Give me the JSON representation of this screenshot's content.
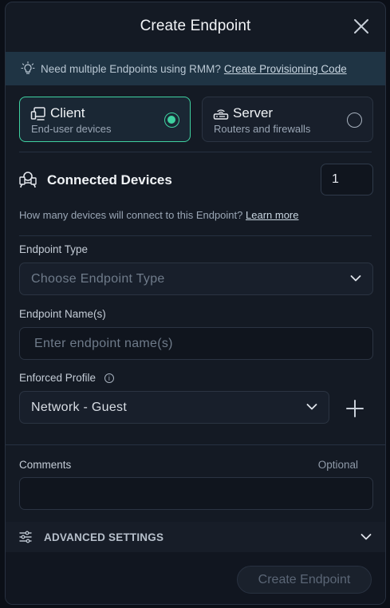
{
  "dialog": {
    "title": "Create Endpoint",
    "banner": {
      "text": "Need multiple Endpoints using RMM?",
      "link": "Create Provisioning Code"
    },
    "options": [
      {
        "name": "Client",
        "description": "End-user devices",
        "selected": true
      },
      {
        "name": "Server",
        "description": "Routers and firewalls",
        "selected": false
      }
    ],
    "connected_devices": {
      "title": "Connected Devices",
      "count": "1",
      "hint": "How many devices will connect to this Endpoint?",
      "hint_link": "Learn more"
    },
    "endpoint_type": {
      "label": "Endpoint Type",
      "placeholder": "Choose Endpoint Type"
    },
    "endpoint_name": {
      "label": "Endpoint Name(s)",
      "placeholder": "Enter endpoint name(s)"
    },
    "enforced_profile": {
      "label": "Enforced Profile",
      "info_glyph": "i",
      "value": "Network - Guest"
    },
    "comments": {
      "label": "Comments",
      "optional": "Optional",
      "value": ""
    },
    "advanced_settings": "ADVANCED SETTINGS",
    "submit": "Create Endpoint"
  },
  "colors": {
    "accent": "#3fd1a0",
    "background": "#141a24",
    "banner": "#1f3444"
  }
}
